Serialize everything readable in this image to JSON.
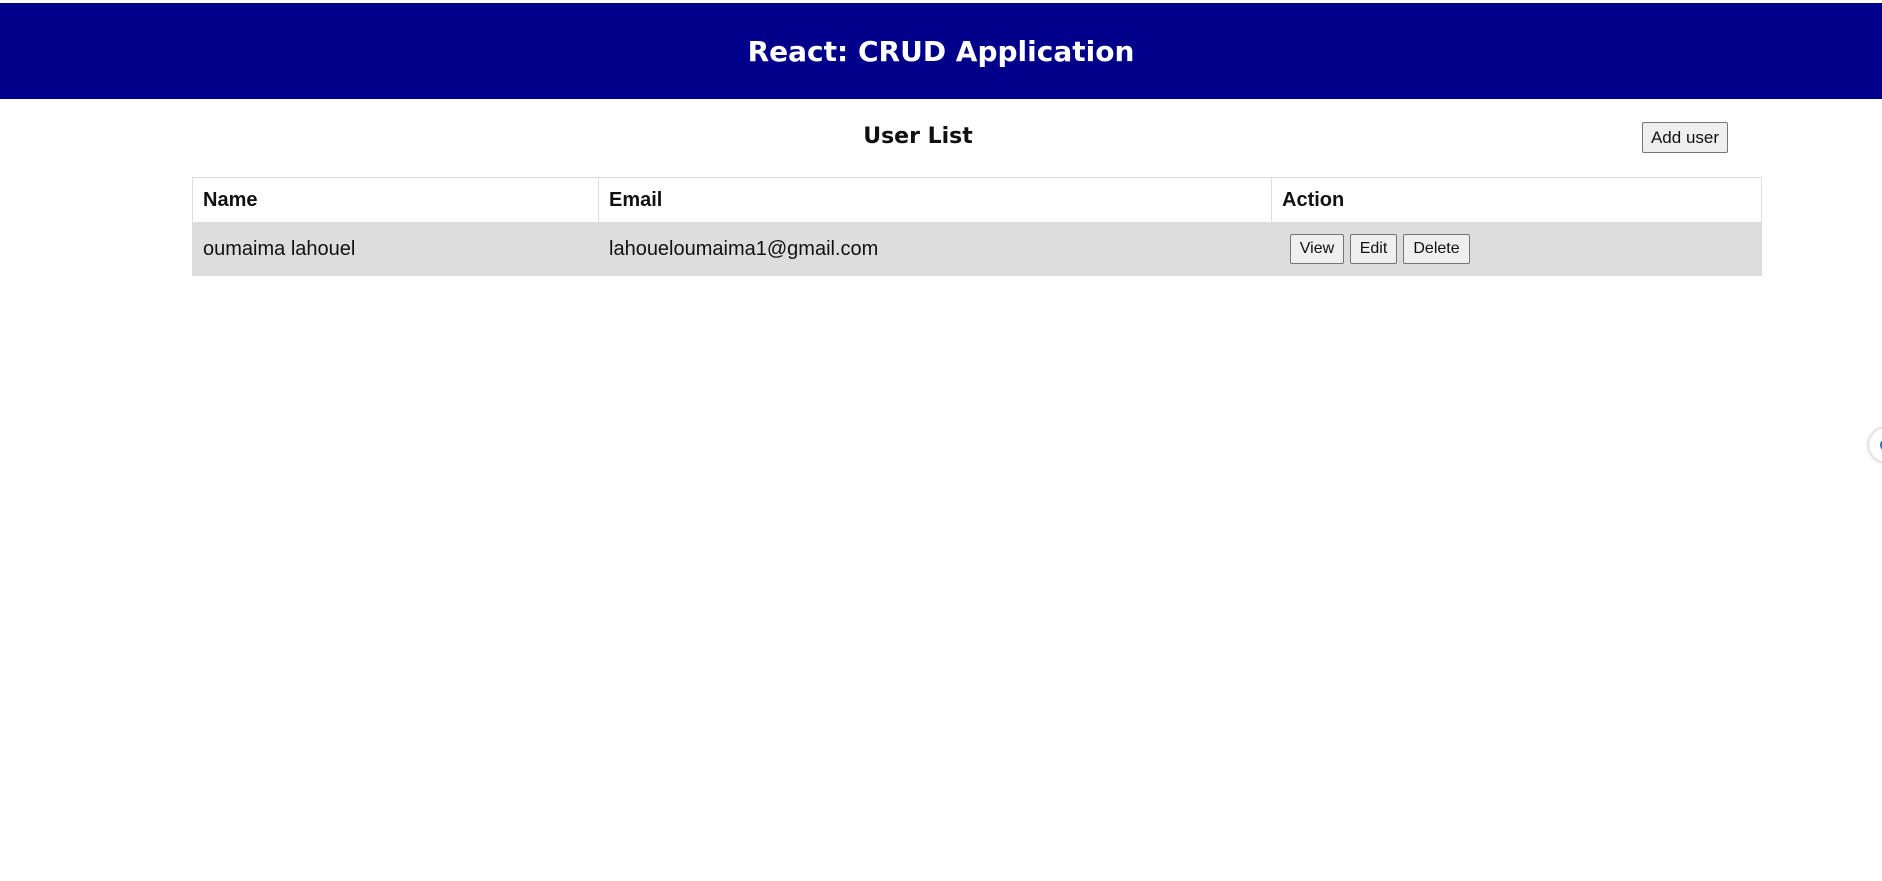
{
  "header": {
    "title": "React: CRUD Application",
    "background_color": "#00008b"
  },
  "user_list": {
    "title": "User List",
    "add_button_label": "Add user",
    "columns": [
      "Name",
      "Email",
      "Action"
    ],
    "rows": [
      {
        "name": "oumaima lahouel",
        "email": "lahoueloumaima1@gmail.com",
        "actions": [
          "View",
          "Edit",
          "Delete"
        ]
      }
    ],
    "row_background_color": "#dddddd"
  },
  "edge_handle": {
    "icon": "circle-handle-icon"
  }
}
